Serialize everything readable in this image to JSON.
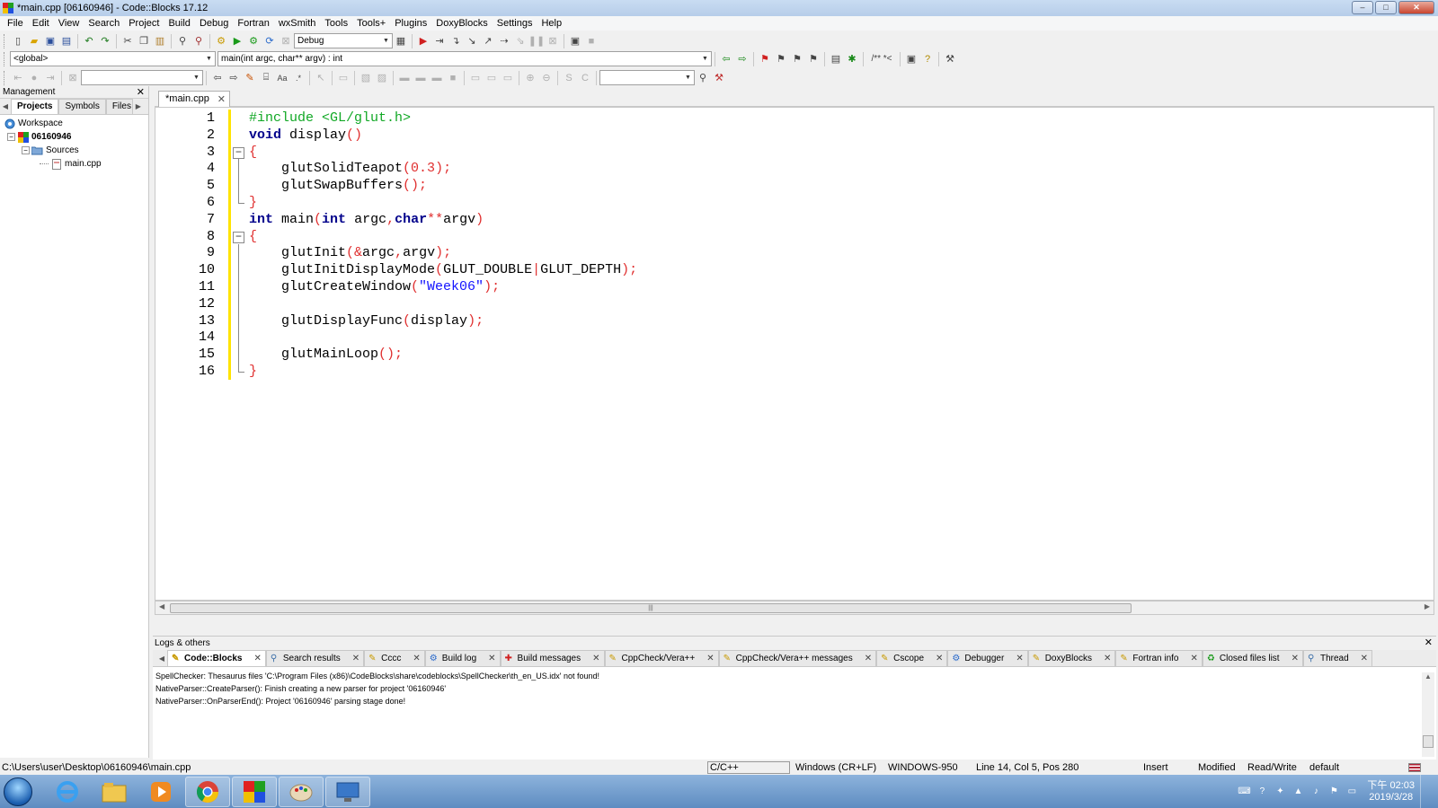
{
  "window": {
    "title": "*main.cpp [06160946] - Code::Blocks 17.12",
    "controls": [
      "–",
      "□",
      "✕"
    ]
  },
  "menu": [
    "File",
    "Edit",
    "View",
    "Search",
    "Project",
    "Build",
    "Debug",
    "Fortran",
    "wxSmith",
    "Tools",
    "Tools+",
    "Plugins",
    "DoxyBlocks",
    "Settings",
    "Help"
  ],
  "toolbar": {
    "build_target": "Debug",
    "scope": "<global>",
    "function": "main(int argc, char** argv) : int",
    "doc_comment_label": "/** *<",
    "search_value": "",
    "symbol_search_value": ""
  },
  "management": {
    "title": "Management",
    "tabs": [
      "Projects",
      "Symbols",
      "Files"
    ],
    "tree": {
      "workspace": "Workspace",
      "project": "06160946",
      "folder": "Sources",
      "file": "main.cpp"
    }
  },
  "editor": {
    "tab_label": "*main.cpp",
    "lines": [
      {
        "n": "1",
        "tokens": [
          [
            "pp",
            "#include <GL/glut.h>"
          ]
        ]
      },
      {
        "n": "2",
        "tokens": [
          [
            "kw",
            "void"
          ],
          [
            "pl",
            " display"
          ],
          [
            "op",
            "()"
          ]
        ]
      },
      {
        "n": "3",
        "tokens": [
          [
            "op",
            "{"
          ]
        ]
      },
      {
        "n": "4",
        "tokens": [
          [
            "pl",
            "    glutSolidTeapot"
          ],
          [
            "op",
            "("
          ],
          [
            "num",
            "0.3"
          ],
          [
            "op",
            ");"
          ]
        ]
      },
      {
        "n": "5",
        "tokens": [
          [
            "pl",
            "    glutSwapBuffers"
          ],
          [
            "op",
            "();"
          ]
        ]
      },
      {
        "n": "6",
        "tokens": [
          [
            "op",
            "}"
          ]
        ]
      },
      {
        "n": "7",
        "tokens": [
          [
            "kw",
            "int"
          ],
          [
            "pl",
            " main"
          ],
          [
            "op",
            "("
          ],
          [
            "kw",
            "int"
          ],
          [
            "pl",
            " argc"
          ],
          [
            "op",
            ","
          ],
          [
            "kw",
            "char"
          ],
          [
            "op",
            "**"
          ],
          [
            "pl",
            "argv"
          ],
          [
            "op",
            ")"
          ]
        ]
      },
      {
        "n": "8",
        "tokens": [
          [
            "op",
            "{"
          ]
        ]
      },
      {
        "n": "9",
        "tokens": [
          [
            "pl",
            "    glutInit"
          ],
          [
            "op",
            "(&"
          ],
          [
            "pl",
            "argc"
          ],
          [
            "op",
            ","
          ],
          [
            "pl",
            "argv"
          ],
          [
            "op",
            ");"
          ]
        ]
      },
      {
        "n": "10",
        "tokens": [
          [
            "pl",
            "    glutInitDisplayMode"
          ],
          [
            "op",
            "("
          ],
          [
            "pl",
            "GLUT_DOUBLE"
          ],
          [
            "op",
            "|"
          ],
          [
            "pl",
            "GLUT_DEPTH"
          ],
          [
            "op",
            ");"
          ]
        ]
      },
      {
        "n": "11",
        "tokens": [
          [
            "pl",
            "    glutCreateWindow"
          ],
          [
            "op",
            "("
          ],
          [
            "str",
            "\"Week06\""
          ],
          [
            "op",
            ");"
          ]
        ]
      },
      {
        "n": "12",
        "tokens": []
      },
      {
        "n": "13",
        "tokens": [
          [
            "pl",
            "    glutDisplayFunc"
          ],
          [
            "op",
            "("
          ],
          [
            "pl",
            "display"
          ],
          [
            "op",
            ");"
          ]
        ]
      },
      {
        "n": "14",
        "tokens": []
      },
      {
        "n": "15",
        "tokens": [
          [
            "pl",
            "    glutMainLoop"
          ],
          [
            "op",
            "();"
          ]
        ]
      },
      {
        "n": "16",
        "tokens": [
          [
            "op",
            "}"
          ]
        ]
      }
    ]
  },
  "logs": {
    "title": "Logs & others",
    "tabs": [
      {
        "label": "Code::Blocks",
        "icon": "page-icon",
        "active": true
      },
      {
        "label": "Search results",
        "icon": "search-icon"
      },
      {
        "label": "Cccc",
        "icon": "page-icon"
      },
      {
        "label": "Build log",
        "icon": "gear-icon"
      },
      {
        "label": "Build messages",
        "icon": "pin-icon"
      },
      {
        "label": "CppCheck/Vera++",
        "icon": "page-icon"
      },
      {
        "label": "CppCheck/Vera++ messages",
        "icon": "page-icon"
      },
      {
        "label": "Cscope",
        "icon": "page-icon"
      },
      {
        "label": "Debugger",
        "icon": "gear-icon"
      },
      {
        "label": "DoxyBlocks",
        "icon": "page-icon"
      },
      {
        "label": "Fortran info",
        "icon": "page-icon"
      },
      {
        "label": "Closed files list",
        "icon": "recycle-icon"
      },
      {
        "label": "Thread",
        "icon": "search-icon"
      }
    ],
    "lines": [
      "SpellChecker: Thesaurus files 'C:\\Program Files (x86)\\CodeBlocks\\share\\codeblocks\\SpellChecker\\th_en_US.idx' not found!",
      "NativeParser::CreateParser(): Finish creating a new parser for project '06160946'",
      "NativeParser::OnParserEnd(): Project '06160946' parsing stage done!"
    ]
  },
  "status": {
    "path": "C:\\Users\\user\\Desktop\\06160946\\main.cpp",
    "language": "C/C++",
    "eol": "Windows (CR+LF)",
    "encoding": "WINDOWS-950",
    "position": "Line 14, Col 5, Pos 280",
    "mode": "Insert",
    "modified": "Modified",
    "access": "Read/Write",
    "profile": "default"
  },
  "taskbar": {
    "apps": [
      "ie-icon",
      "explorer-icon",
      "media-player-icon",
      "chrome-icon",
      "codeblocks-icon",
      "paint-icon",
      "remote-desktop-icon"
    ],
    "clock_time": "下午 02:03",
    "clock_date": "2019/3/28"
  },
  "colors": {
    "keyword": "#00008b",
    "preprocessor": "#11a825",
    "operator": "#e03030",
    "string": "#1414ff",
    "change_bar": "#ffe300"
  }
}
